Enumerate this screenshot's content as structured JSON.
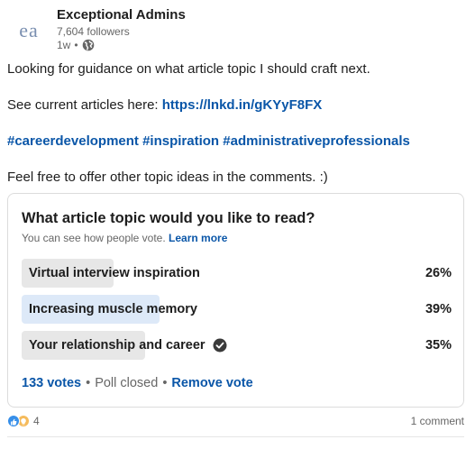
{
  "author": {
    "logo_text": "ea",
    "name": "Exceptional Admins",
    "followers": "7,604 followers",
    "time": "1w",
    "visibility_icon": "globe-icon"
  },
  "post": {
    "line1": "Looking for guidance on what article topic I should craft next.",
    "line2_prefix": "See current articles here: ",
    "line2_link": "https://lnkd.in/gKYyF8FX",
    "hashtags": "#careerdevelopment #inspiration #administrativeprofessionals",
    "line4": "Feel free to offer other topic ideas in the comments. :)"
  },
  "poll": {
    "question": "What article topic would you like to read?",
    "sub_text": "You can see how people vote.",
    "learn_more": "Learn more",
    "options": [
      {
        "label": "Virtual interview inspiration",
        "percent_label": "26%",
        "percent": 26,
        "selected": false
      },
      {
        "label": "Increasing muscle memory",
        "percent_label": "39%",
        "percent": 39,
        "selected": false
      },
      {
        "label": "Your relationship and career",
        "percent_label": "35%",
        "percent": 35,
        "selected": true
      }
    ],
    "votes": "133 votes",
    "status": "Poll closed",
    "remove_vote": "Remove vote",
    "separator": "•"
  },
  "social": {
    "reaction_icons": [
      "like-icon",
      "insightful-icon"
    ],
    "reaction_count": "4",
    "comments": "1 comment"
  },
  "colors": {
    "link": "#0a56a8",
    "option_fill": "#e7e7e7",
    "option_fill_highlight": "#dde9f8"
  }
}
